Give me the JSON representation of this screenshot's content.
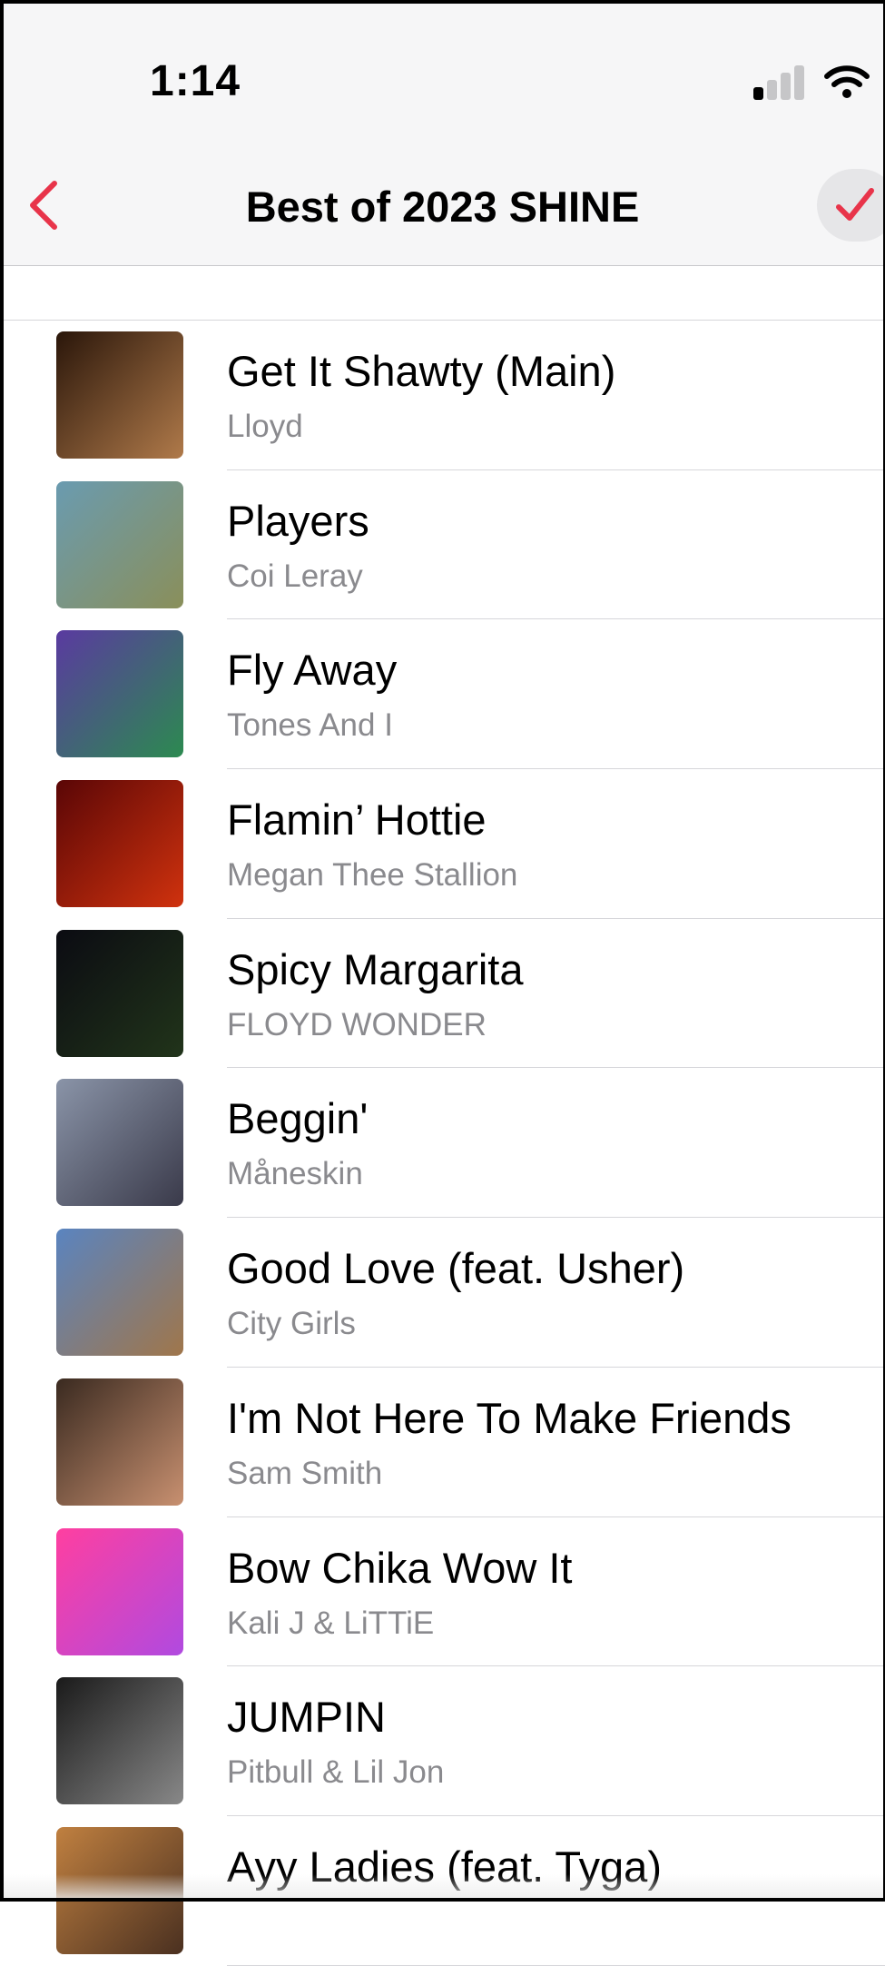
{
  "status_bar": {
    "time": "1:14"
  },
  "nav": {
    "title": "Best of 2023 SHINE"
  },
  "colors": {
    "accent": "#e8344a",
    "secondary_text": "#8a8a8e"
  },
  "songs": [
    {
      "title": "Get It Shawty (Main)",
      "artist": "Lloyd",
      "art": [
        "#2a160a",
        "#b07a4a"
      ]
    },
    {
      "title": "Players",
      "artist": "Coi Leray",
      "art": [
        "#6a9bb0",
        "#8a8f5a"
      ]
    },
    {
      "title": "Fly Away",
      "artist": "Tones And I",
      "art": [
        "#5a3aa0",
        "#2c8a50"
      ]
    },
    {
      "title": "Flamin’ Hottie",
      "artist": "Megan Thee Stallion",
      "art": [
        "#5a0606",
        "#d0320e"
      ]
    },
    {
      "title": "Spicy Margarita",
      "artist": "FLOYD WONDER",
      "art": [
        "#0b0b12",
        "#21341a"
      ]
    },
    {
      "title": "Beggin'",
      "artist": "Måneskin",
      "art": [
        "#8a94a8",
        "#3a3a4a"
      ]
    },
    {
      "title": "Good Love (feat. Usher)",
      "artist": "City Girls",
      "art": [
        "#5a84c0",
        "#a0764a"
      ]
    },
    {
      "title": "I'm Not Here To Make Friends",
      "artist": "Sam Smith",
      "art": [
        "#3a2a20",
        "#c89070"
      ]
    },
    {
      "title": "Bow Chika Wow It",
      "artist": "Kali J & LiTTiE",
      "art": [
        "#ff3fa0",
        "#b04ae0"
      ]
    },
    {
      "title": "JUMPIN",
      "artist": "Pitbull & Lil Jon",
      "art": [
        "#1a1a1a",
        "#888888"
      ]
    },
    {
      "title": "Ayy Ladies (feat. Tyga)",
      "artist": "",
      "art": [
        "#c08040",
        "#4a3020"
      ]
    }
  ]
}
